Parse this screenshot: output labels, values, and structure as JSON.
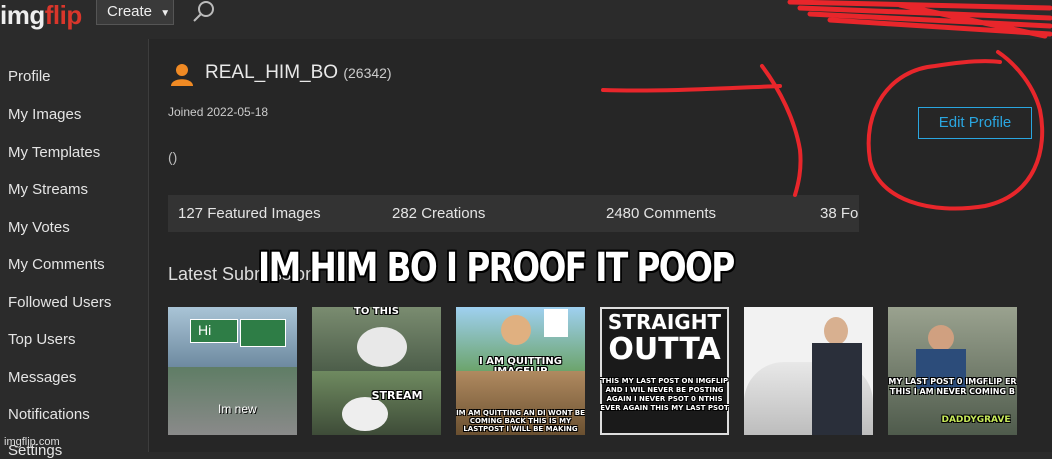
{
  "header": {
    "logo_part1": "img",
    "logo_part2": "flip",
    "create_label": "Create",
    "search_icon": "search-icon"
  },
  "sidebar": {
    "items": [
      {
        "label": "Profile"
      },
      {
        "label": "My Images"
      },
      {
        "label": "My Templates"
      },
      {
        "label": "My Streams"
      },
      {
        "label": "My Votes"
      },
      {
        "label": "My Comments"
      },
      {
        "label": "Followed Users"
      },
      {
        "label": "Top Users"
      },
      {
        "label": "Messages"
      },
      {
        "label": "Notifications"
      },
      {
        "label": "Settings"
      }
    ]
  },
  "profile": {
    "username": "REAL_HIM_BO",
    "points": "(26342)",
    "joined": "Joined 2022-05-18",
    "bio": "()",
    "edit_label": "Edit Profile"
  },
  "stats": {
    "featured": "127 Featured Images",
    "creations": "282 Creations",
    "comments": "2480 Comments",
    "followers_partial": "38 Fo"
  },
  "latest_heading": "Latest Submissions",
  "caption": "IM HIM BO I PROOF IT POOP",
  "thumbnails": [
    {
      "texts": [
        "Hi",
        "Im new"
      ]
    },
    {
      "texts": [
        "TO THIS",
        "STREAM"
      ]
    },
    {
      "texts": [
        "I AM QUITTING IMAGFLIP",
        "IM AM QUITTING AN DI WONT BE COMING BACK THIS IS MY LASTPOST I WILL BE MAKING"
      ]
    },
    {
      "texts": [
        "STRAIGHT",
        "OUTTA",
        "THIS MY LAST POST ON IMGFLIP AND I WIL NEVER BE POSTING AGAIN I NEVER PSOT 0 NTHIS EVER AGAIN THIS MY LAST PSOT"
      ]
    },
    {
      "texts": []
    },
    {
      "texts": [
        "MY LAST POST 0 IMGFLIP ER THIS I AM NEVER COMING B",
        "DADDYGRAVE"
      ]
    }
  ],
  "watermark": "imgflip.com",
  "colors": {
    "background": "#2b2b2b",
    "accent": "#2aa6e0",
    "brand_red": "#d9362b",
    "user_icon": "#f08a24",
    "scribble": "#e8262b"
  }
}
